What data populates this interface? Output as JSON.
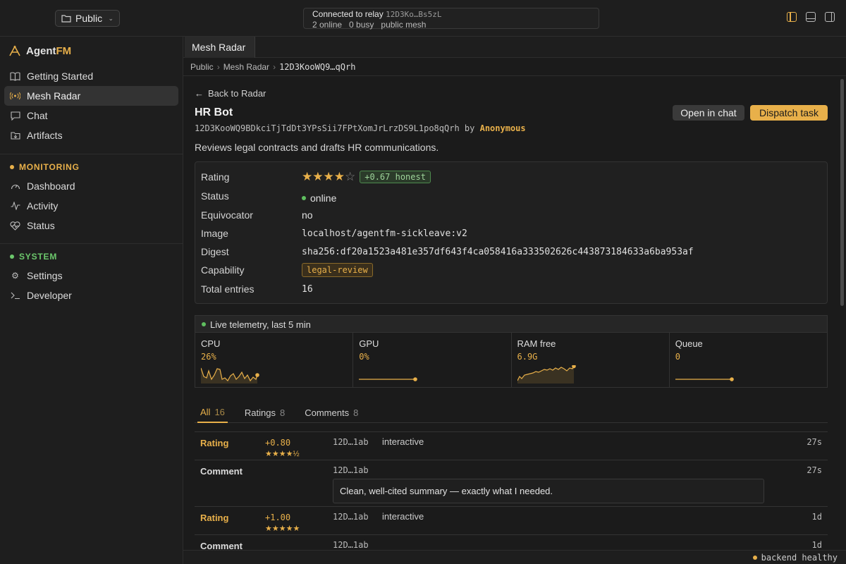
{
  "topbar": {
    "folder_label": "Public",
    "relay_label": "Connected to relay",
    "relay_id": "12D3Ko…Bs5zL",
    "online": "2 online",
    "busy": "0 busy",
    "mesh": "public mesh"
  },
  "sidebar": {
    "brand_a": "Agent",
    "brand_b": "FM",
    "items": [
      {
        "label": "Getting Started",
        "icon": "book-icon"
      },
      {
        "label": "Mesh Radar",
        "icon": "radar-icon"
      },
      {
        "label": "Chat",
        "icon": "chat-icon"
      },
      {
        "label": "Artifacts",
        "icon": "download-folder-icon"
      }
    ],
    "monitoring_label": "MONITORING",
    "monitoring_items": [
      {
        "label": "Dashboard",
        "icon": "gauge-icon"
      },
      {
        "label": "Activity",
        "icon": "pulse-icon"
      },
      {
        "label": "Status",
        "icon": "heart-icon"
      }
    ],
    "system_label": "SYSTEM",
    "system_items": [
      {
        "label": "Settings",
        "icon": "gear-icon"
      },
      {
        "label": "Developer",
        "icon": "terminal-icon"
      }
    ]
  },
  "tab": {
    "label": "Mesh Radar"
  },
  "breadcrumb": [
    "Public",
    "Mesh Radar",
    "12D3KooWQ9…qQrh"
  ],
  "agent": {
    "back_label": "Back to Radar",
    "name": "HR Bot",
    "id": "12D3KooWQ9BDkciTjTdDt3YPsSii7FPtXomJrLrzDS9L1po8qQrh",
    "by": "by",
    "owner": "Anonymous",
    "open_chat": "Open in chat",
    "dispatch": "Dispatch task",
    "description": "Reviews legal contracts and drafts HR communications."
  },
  "details": {
    "rating_label": "Rating",
    "rating_stars": 4,
    "rating_badge": "+0.67 honest",
    "status_label": "Status",
    "status_value": "online",
    "equivocator_label": "Equivocator",
    "equivocator_value": "no",
    "image_label": "Image",
    "image_value": "localhost/agentfm-sickleave:v2",
    "digest_label": "Digest",
    "digest_value": "sha256:df20a1523a481e357df643f4ca058416a333502626c443873184633a6ba953af",
    "capability_label": "Capability",
    "capability_value": "legal-review",
    "entries_label": "Total entries",
    "entries_value": "16"
  },
  "telemetry": {
    "title": "Live telemetry, last 5 min",
    "metrics": [
      {
        "name": "CPU",
        "value": "26%"
      },
      {
        "name": "GPU",
        "value": "0%"
      },
      {
        "name": "RAM free",
        "value": "6.9G"
      },
      {
        "name": "Queue",
        "value": "0"
      }
    ]
  },
  "review_tabs": [
    {
      "label": "All",
      "count": "16"
    },
    {
      "label": "Ratings",
      "count": "8"
    },
    {
      "label": "Comments",
      "count": "8"
    }
  ],
  "feed": [
    {
      "kind": "Rating",
      "score": "+0.80",
      "stars": "★★★★½",
      "source": "12D…1ab",
      "mode": "interactive",
      "age": "27s"
    },
    {
      "kind": "Comment",
      "source": "12D…1ab",
      "text": "Clean, well-cited summary — exactly what I needed.",
      "age": "27s"
    },
    {
      "kind": "Rating",
      "score": "+1.00",
      "stars": "★★★★★",
      "source": "12D…1ab",
      "mode": "interactive",
      "age": "1d"
    },
    {
      "kind": "Comment",
      "source": "12D…1ab",
      "age": "1d"
    }
  ],
  "statusbar": {
    "label": "backend healthy"
  }
}
